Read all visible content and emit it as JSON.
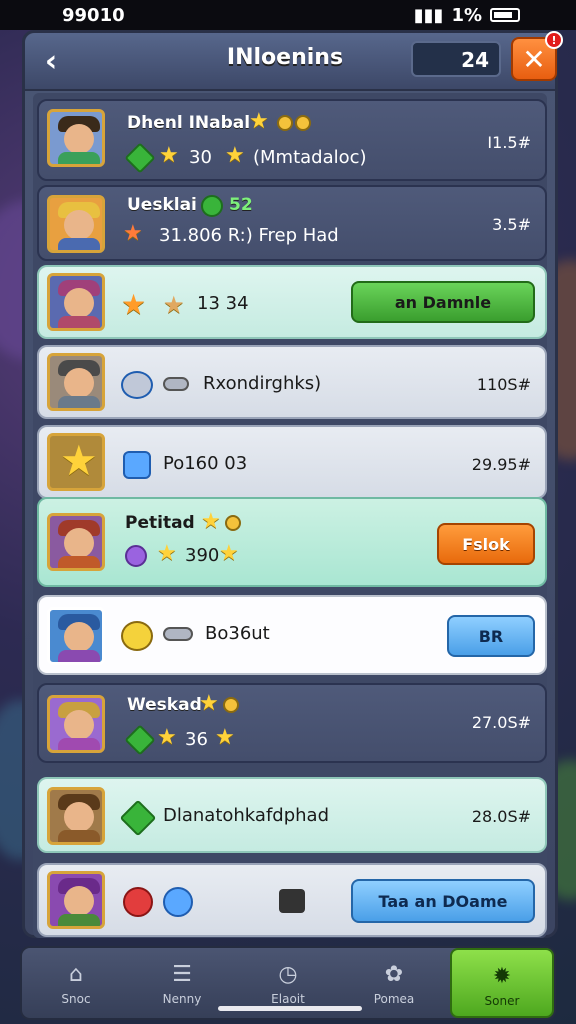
{
  "status_bar": {
    "time": "99010",
    "battery": "1%"
  },
  "header": {
    "title": "INloenins",
    "counter": "24",
    "close_badge": "!"
  },
  "rows": [
    {
      "name": "Dhenl INabal",
      "sub": "30",
      "sub2": "(Mmtadaloc)",
      "value": "I1.5#"
    },
    {
      "name": "Uesklai",
      "name_num": "52",
      "sub": "31.806 R:) Frep Had",
      "value": "3.5#"
    },
    {
      "sub": "13 34",
      "button": "an Damnle"
    },
    {
      "sub": "Rxondirghks)",
      "value": "110S#"
    },
    {
      "sub": "Po160 03",
      "value": "29.95#"
    },
    {
      "name": "Petitad",
      "sub": "390",
      "button": "Fslok"
    },
    {
      "sub": "Bo36ut",
      "button": "BR"
    },
    {
      "name": "Weskad",
      "sub": "36",
      "value": "27.0S#"
    },
    {
      "sub": "Dlanatohkafdphad",
      "value": "28.0S#"
    },
    {
      "button": "Taa an DOame"
    }
  ],
  "nav": [
    {
      "label": "Snoc",
      "icon": "home-icon"
    },
    {
      "label": "Nenny",
      "icon": "menu-icon"
    },
    {
      "label": "Elaoit",
      "icon": "clock-icon"
    },
    {
      "label": "Pomea",
      "icon": "people-icon"
    },
    {
      "label": "Soner",
      "icon": "settings-icon",
      "active": true
    }
  ]
}
